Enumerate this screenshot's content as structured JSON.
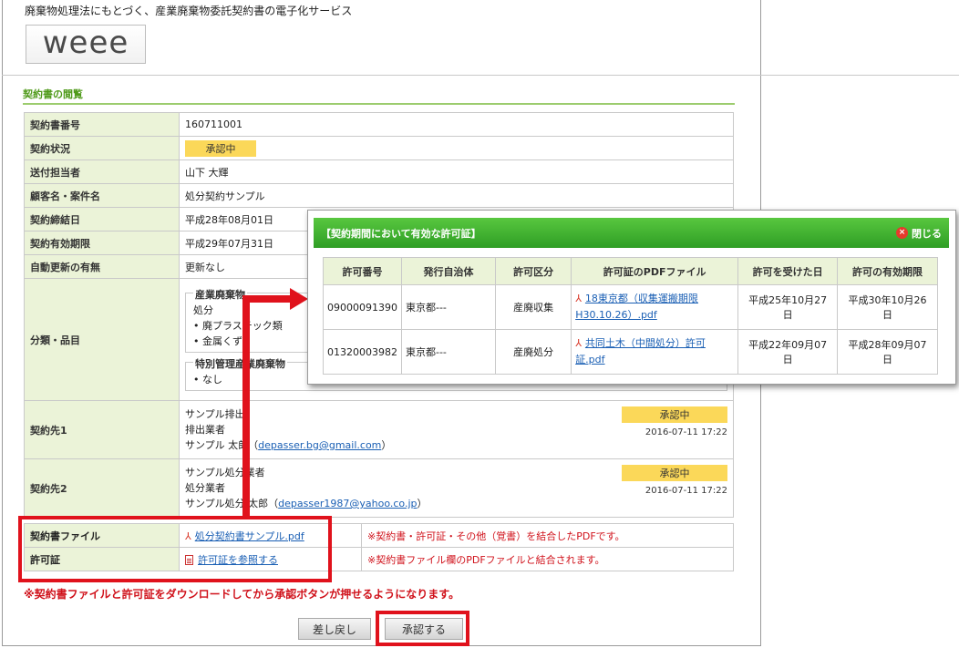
{
  "header": {
    "tagline": "廃棄物処理法にもとづく、産業廃棄物委託契約書の電子化サービス",
    "logo": "weee"
  },
  "section_title": "契約書の閲覧",
  "contract": {
    "number": {
      "label": "契約書番号",
      "value": "160711001"
    },
    "status": {
      "label": "契約状況",
      "value": "承認中"
    },
    "sender": {
      "label": "送付担当者",
      "value": "山下 大輝"
    },
    "client": {
      "label": "顧客名・案件名",
      "value": "処分契約サンプル"
    },
    "signed": {
      "label": "契約締結日",
      "value": "平成28年08月01日"
    },
    "expiry": {
      "label": "契約有効期限",
      "value": "平成29年07月31日"
    },
    "renewal": {
      "label": "自動更新の有無",
      "value": "更新なし"
    },
    "category": {
      "label": "分類・品目",
      "industrial_legend": "産業廃棄物",
      "industrial_sub": "処分",
      "industrial_items": [
        "• 廃プラスチック類",
        "• 金属くず"
      ],
      "special_legend": "特別管理産業廃棄物",
      "special_items": [
        "• なし"
      ]
    },
    "party1": {
      "label": "契約先1",
      "company": "サンプル排出",
      "role": "排出業者",
      "person": "サンプル 太郎",
      "email": "depasser.bg@gmail.com",
      "status": "承認中",
      "time": "2016-07-11 17:22"
    },
    "party2": {
      "label": "契約先2",
      "company": "サンプル処分業者",
      "role": "処分業者",
      "person": "サンプル処分 太郎",
      "email": "depasser1987@yahoo.co.jp",
      "status": "承認中",
      "time": "2016-07-11 17:22"
    }
  },
  "files": {
    "contract_file": {
      "label": "契約書ファイル",
      "link": "処分契約書サンプル.pdf",
      "note": "※契約書・許可証・その他（覚書）を結合したPDFです。"
    },
    "license": {
      "label": "許可証",
      "link": "許可証を参照する",
      "note": "※契約書ファイル欄のPDFファイルと結合されます。"
    }
  },
  "warning": "※契約書ファイルと許可証をダウンロードしてから承認ボタンが押せるようになります。",
  "buttons": {
    "back": "差し戻し",
    "approve": "承認する"
  },
  "modal": {
    "title": "【契約期間において有効な許可証】",
    "close": "閉じる",
    "columns": [
      "許可番号",
      "発行自治体",
      "許可区分",
      "許可証のPDFファイル",
      "許可を受けた日",
      "許可の有効期限"
    ],
    "rows": [
      {
        "number": "09000091390",
        "issuer": "東京都---",
        "type": "産廃収集",
        "file_a": "18東京都（収集運搬期限",
        "file_b": "H30.10.26）.pdf",
        "granted_a": "平成25年10月27",
        "granted_b": "日",
        "expires_a": "平成30年10月26",
        "expires_b": "日"
      },
      {
        "number": "01320003982",
        "issuer": "東京都---",
        "type": "産廃処分",
        "file_a": "共同土木（中間処分）許可",
        "file_b": "証.pdf",
        "granted_a": "平成22年09月07",
        "granted_b": "日",
        "expires_a": "平成28年09月07",
        "expires_b": "日"
      }
    ]
  }
}
